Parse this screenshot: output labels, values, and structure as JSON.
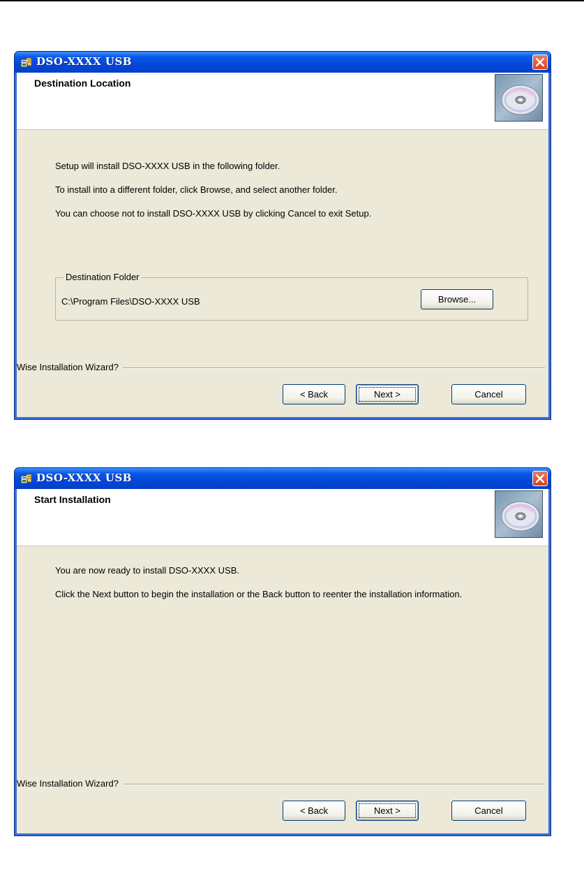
{
  "dialogs": [
    {
      "window_title": "DSO-XXXX USB",
      "header_title": "Destination Location",
      "lines": [
        "Setup will install DSO-XXXX USB in the following folder.",
        "To install into a different folder, click Browse, and select another folder.",
        "You can choose not to install DSO-XXXX USB by clicking Cancel to exit Setup."
      ],
      "destination_group_label": "Destination Folder",
      "destination_path": "C:\\Program Files\\DSO-XXXX USB",
      "browse_label": "Browse...",
      "wizard_brand": "Wise Installation Wizard?",
      "back_label": "< Back",
      "next_label": "Next >",
      "cancel_label": "Cancel"
    },
    {
      "window_title": "DSO-XXXX USB",
      "header_title": "Start Installation",
      "lines": [
        "You are now ready to install DSO-XXXX USB.",
        "Click the Next button to begin the installation or the Back button to reenter the installation information."
      ],
      "wizard_brand": "Wise Installation Wizard?",
      "back_label": "< Back",
      "next_label": "Next >",
      "cancel_label": "Cancel"
    }
  ],
  "icons": {
    "app": "installer-icon",
    "close": "close-icon",
    "header_graphic": "cd-disc-icon"
  },
  "colors": {
    "titlebar": "#0447d9",
    "dialog_face": "#ece9d8",
    "close_button": "#d8431e"
  }
}
